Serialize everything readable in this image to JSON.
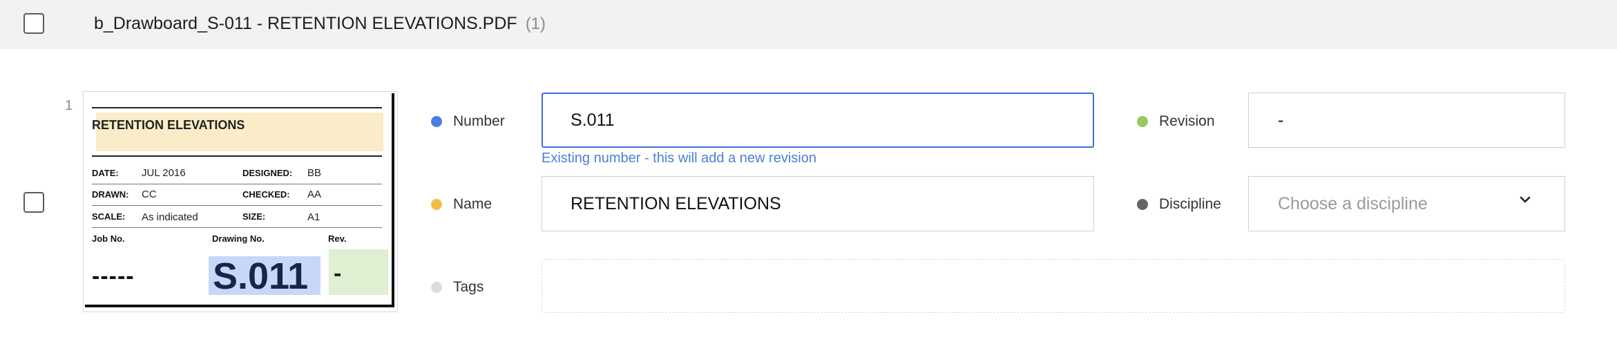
{
  "header": {
    "filename": "b_Drawboard_S-011 - RETENTION ELEVATIONS.PDF",
    "count": "(1)"
  },
  "row": {
    "index": "1"
  },
  "thumbnail": {
    "title": "RETENTION ELEVATIONS",
    "date_label": "DATE:",
    "date_value": "JUL 2016",
    "designed_label": "DESIGNED:",
    "designed_value": "BB",
    "drawn_label": "DRAWN:",
    "drawn_value": "CC",
    "checked_label": "CHECKED:",
    "checked_value": "AA",
    "scale_label": "SCALE:",
    "scale_value": "As indicated",
    "size_label": "SIZE:",
    "size_value": "A1",
    "job_no_label": "Job No.",
    "drawing_no_label": "Drawing No.",
    "rev_label": "Rev.",
    "job_no_value": "-----",
    "drawing_no_value": "S.011",
    "rev_value": "-"
  },
  "fields": {
    "number": {
      "label": "Number",
      "value": "S.011",
      "hint": "Existing number - this will add a new revision",
      "dot_color": "#4a7fe0"
    },
    "name": {
      "label": "Name",
      "value": "RETENTION ELEVATIONS",
      "dot_color": "#f2be45"
    },
    "tags": {
      "label": "Tags",
      "dot_color": "#dddddd"
    },
    "revision": {
      "label": "Revision",
      "value": "-",
      "dot_color": "#93cc5a"
    },
    "discipline": {
      "label": "Discipline",
      "placeholder": "Choose a discipline",
      "dot_color": "#666666"
    }
  },
  "icons": {
    "dropdown": "chevron-down-icon"
  }
}
